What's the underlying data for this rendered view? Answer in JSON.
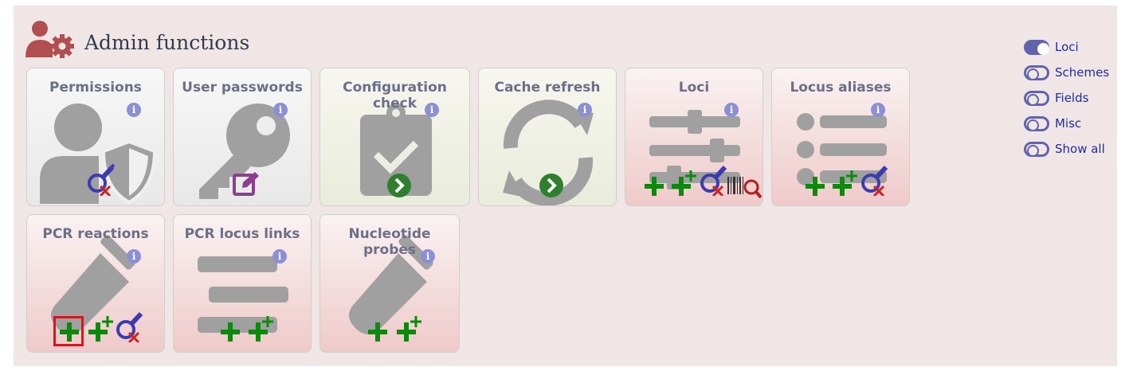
{
  "header": {
    "title": "Admin functions",
    "icon": "admin-user-gear-icon",
    "icon_color": "#b14f50"
  },
  "tiles": [
    {
      "id": "permissions",
      "title": "Permissions",
      "style": "gray",
      "icon": "user-shield-icon",
      "actions": [
        "query-edit-icon"
      ]
    },
    {
      "id": "user-passwords",
      "title": "User passwords",
      "style": "gray",
      "icon": "key-icon",
      "actions": [
        "edit-icon"
      ]
    },
    {
      "id": "configuration-check",
      "title": "Configuration check",
      "style": "green",
      "icon": "clipboard-check-icon",
      "actions": [
        "go-icon"
      ]
    },
    {
      "id": "cache-refresh",
      "title": "Cache refresh",
      "style": "green",
      "icon": "sync-icon",
      "actions": [
        "go-icon"
      ]
    },
    {
      "id": "loci",
      "title": "Loci",
      "style": "pink",
      "icon": "sliders-icon",
      "actions": [
        "add-icon",
        "batch-add-icon",
        "query-edit-icon",
        "barcode-search-icon"
      ]
    },
    {
      "id": "locus-aliases",
      "title": "Locus aliases",
      "style": "pink",
      "icon": "list-icon",
      "actions": [
        "add-icon",
        "batch-add-icon",
        "query-edit-icon"
      ]
    },
    {
      "id": "pcr-reactions",
      "title": "PCR reactions",
      "style": "pink",
      "icon": "test-tube-icon",
      "actions": [
        "add-icon",
        "batch-add-icon",
        "query-edit-icon"
      ]
    },
    {
      "id": "pcr-locus-links",
      "title": "PCR locus links",
      "style": "pink",
      "icon": "align-lines-icon",
      "actions": [
        "add-icon",
        "batch-add-icon"
      ]
    },
    {
      "id": "nucleotide-probes",
      "title": "Nucleotide probes",
      "style": "pink",
      "icon": "test-tube-icon",
      "actions": [
        "add-icon",
        "batch-add-icon"
      ]
    }
  ],
  "info_label": "i",
  "toggles": [
    {
      "label": "Loci",
      "on": true
    },
    {
      "label": "Schemes",
      "on": false
    },
    {
      "label": "Fields",
      "on": false
    },
    {
      "label": "Misc",
      "on": false
    },
    {
      "label": "Show all",
      "on": false
    }
  ],
  "colors": {
    "add": "#0b8a0b",
    "query": "#3c3cb0",
    "delete_x": "#d02020",
    "go": "#2f7f2f",
    "edit": "#8c3f8f",
    "info": "#8d8fd3",
    "icon_gray": "#a0a0a0"
  }
}
